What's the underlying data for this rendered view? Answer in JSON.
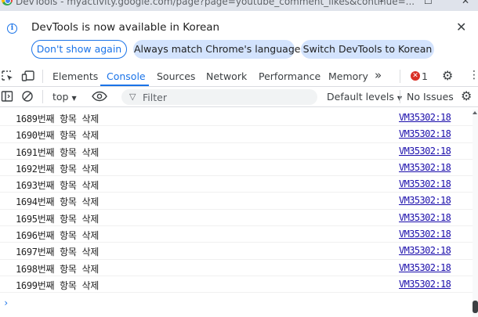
{
  "window": {
    "title": "DevTools - myactivity.google.com/page?page=youtube_comment_likes&continue=..."
  },
  "infobar": {
    "message": "DevTools is now available in Korean",
    "dont_show_again": "Don't show again",
    "always_match": "Always match Chrome's language",
    "switch_korean": "Switch DevTools to Korean",
    "close_glyph": "✕"
  },
  "tabs": {
    "items": [
      "Elements",
      "Console",
      "Sources",
      "Network",
      "Performance",
      "Memory"
    ],
    "active": "Console",
    "more_glyph": "»",
    "error_count": "1"
  },
  "filterbar": {
    "context": "top",
    "filter_placeholder": "Filter",
    "default_levels": "Default levels",
    "issues": "No Issues"
  },
  "console": {
    "messages": [
      {
        "text": "1689번째 항목 삭제",
        "source": "VM35302:18"
      },
      {
        "text": "1690번째 항목 삭제",
        "source": "VM35302:18"
      },
      {
        "text": "1691번째 항목 삭제",
        "source": "VM35302:18"
      },
      {
        "text": "1692번째 항목 삭제",
        "source": "VM35302:18"
      },
      {
        "text": "1693번째 항목 삭제",
        "source": "VM35302:18"
      },
      {
        "text": "1694번째 항목 삭제",
        "source": "VM35302:18"
      },
      {
        "text": "1695번째 항목 삭제",
        "source": "VM35302:18"
      },
      {
        "text": "1696번째 항목 삭제",
        "source": "VM35302:18"
      },
      {
        "text": "1697번째 항목 삭제",
        "source": "VM35302:18"
      },
      {
        "text": "1698번째 항목 삭제",
        "source": "VM35302:18"
      },
      {
        "text": "1699번째 항목 삭제",
        "source": "VM35302:18"
      }
    ],
    "prompt_glyph": "›"
  },
  "colors": {
    "accent": "#1a73e8",
    "pill_bg": "#d3e3fd",
    "error": "#d93025",
    "link": "#1a0dab"
  },
  "icons": [
    "chrome-logo-icon",
    "info-icon",
    "close-icon",
    "inspect-element-icon",
    "device-toolbar-icon",
    "error-icon",
    "settings-gear-icon",
    "kebab-menu-icon",
    "sidebar-toggle-icon",
    "clear-console-icon",
    "eye-icon",
    "filter-icon",
    "caret-down-icon"
  ]
}
